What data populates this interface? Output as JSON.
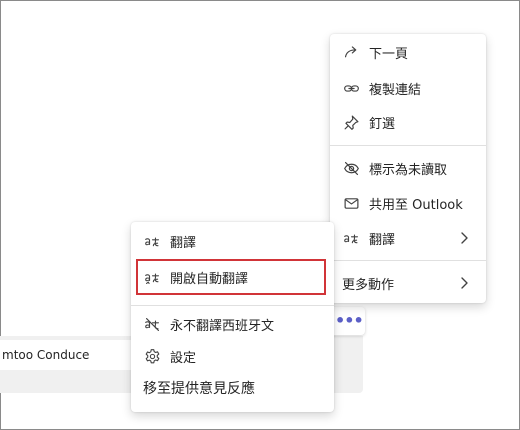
{
  "message": {
    "text": "mtoo Conduce",
    "more_actions_glyph": "•••"
  },
  "context_menu": {
    "items": [
      {
        "label": "下一頁",
        "icon": "forward-arrow-icon"
      },
      {
        "label": "複製連結",
        "icon": "link-icon"
      },
      {
        "label": "釘選",
        "icon": "pin-icon"
      },
      {
        "label": "標示為未讀取",
        "icon": "eye-off-icon"
      },
      {
        "label": "共用至 Outlook",
        "icon": "mail-icon"
      },
      {
        "label": "翻譯",
        "icon": "translate-icon",
        "submenu": true
      },
      {
        "label": "更多動作",
        "submenu": true
      }
    ]
  },
  "translate_submenu": {
    "items": [
      {
        "label": "翻譯",
        "icon": "translate-icon"
      },
      {
        "label": "開啟自動翻譯",
        "icon": "auto-translate-icon",
        "highlighted": true
      },
      {
        "label": "永不翻譯西班牙文",
        "icon": "translate-off-icon"
      },
      {
        "label": "設定",
        "icon": "gear-icon"
      },
      {
        "label": "移至提供意見反應"
      }
    ]
  },
  "colors": {
    "highlight_border": "#d13438",
    "accent": "#5b5fc7",
    "text": "#242424"
  }
}
